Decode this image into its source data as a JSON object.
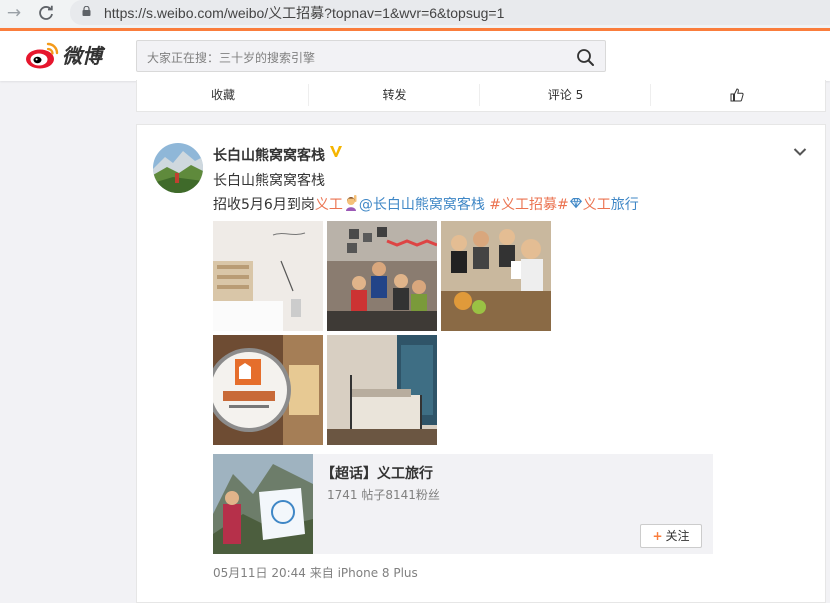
{
  "browser": {
    "url": "https://s.weibo.com/weibo/义工招募?topnav=1&wvr=6&topsug=1"
  },
  "header": {
    "logo_text": "微博",
    "search_placeholder": "大家正在搜：三十岁的搜索引擎"
  },
  "prev_actions": {
    "favorite": "收藏",
    "repost": "转发",
    "comment": "评论 5"
  },
  "post": {
    "username": "长白山熊窝窝客栈",
    "subname": "长白山熊窝窝客栈",
    "text_parts": {
      "prefix": "招收5月6月到岗",
      "link_volunteer": "义工",
      "mention": "@长白山熊窝窝客栈",
      "hashtag": "#义工招募#",
      "supertopic": "义工旅行"
    },
    "images": [
      "bedroom-headboard-photo",
      "group-party-photo",
      "group-selfie-photo",
      "hostel-sign-photo",
      "bunk-room-photo"
    ],
    "topic_card": {
      "title": "【超话】义工旅行",
      "stats": "1741 帖子8141粉丝",
      "follow_label": "关注"
    },
    "meta": "05月11日 20:44 来自 iPhone 8 Plus"
  },
  "colors": {
    "brand_orange": "#fa7d3c",
    "link_blue": "#3f87c6",
    "hashtag_red": "#eb7350"
  }
}
